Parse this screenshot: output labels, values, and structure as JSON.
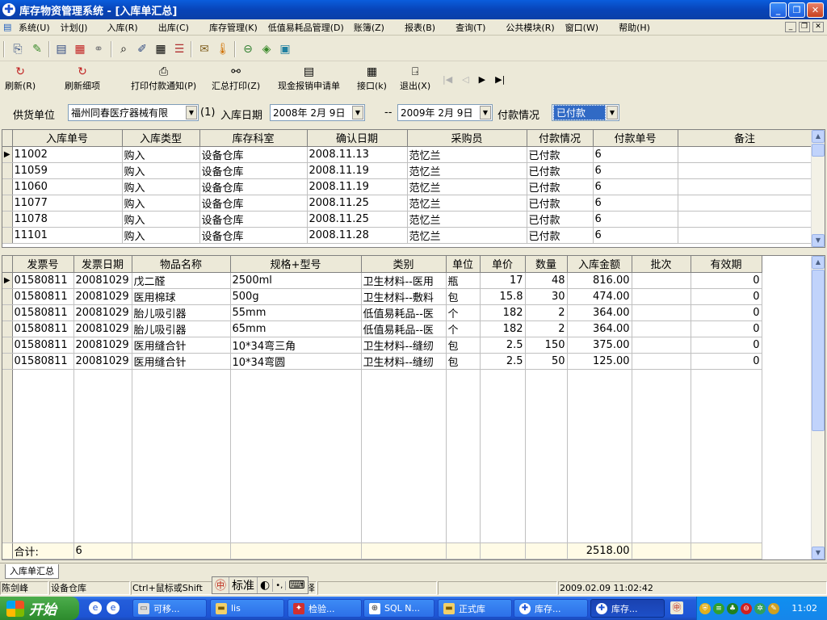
{
  "window": {
    "title": "库存物资管理系统 - [入库单汇总]",
    "app_icon": "cross-icon"
  },
  "menu": [
    "系统(U)",
    "计划(J)",
    "入库(R)",
    "出库(C)",
    "库存管理(K)",
    "低值易耗品管理(D)",
    "账簿(Z)",
    "报表(B)",
    "查询(T)",
    "公共模块(R)",
    "窗口(W)",
    "帮助(H)"
  ],
  "toolbar2": {
    "refresh": "刷新(R)",
    "refresh_detail": "刷新细项",
    "print_notice": "打印付款通知(P)",
    "print_summary": "汇总打印(Z)",
    "cash_request": "现金报销申请单",
    "interface": "接口(k)",
    "exit": "退出(X)"
  },
  "filter": {
    "supplier_label": "供货单位",
    "supplier_value": "福州同春医疗器械有限",
    "marker": "(1)",
    "date_label": "入库日期",
    "date_from": "2008年 2月 9日",
    "dash": "--",
    "date_to": "2009年 2月 9日",
    "payment_label": "付款情况",
    "payment_value": "已付款"
  },
  "top_grid": {
    "headers": [
      "入库单号",
      "入库类型",
      "库存科室",
      "确认日期",
      "采购员",
      "付款情况",
      "付款单号",
      "备注"
    ],
    "rows": [
      [
        "11002",
        "购入",
        "设备仓库",
        "2008.11.13",
        "范忆兰",
        "已付款",
        "6",
        ""
      ],
      [
        "11059",
        "购入",
        "设备仓库",
        "2008.11.19",
        "范忆兰",
        "已付款",
        "6",
        ""
      ],
      [
        "11060",
        "购入",
        "设备仓库",
        "2008.11.19",
        "范忆兰",
        "已付款",
        "6",
        ""
      ],
      [
        "11077",
        "购入",
        "设备仓库",
        "2008.11.25",
        "范忆兰",
        "已付款",
        "6",
        ""
      ],
      [
        "11078",
        "购入",
        "设备仓库",
        "2008.11.25",
        "范忆兰",
        "已付款",
        "6",
        ""
      ],
      [
        "11101",
        "购入",
        "设备仓库",
        "2008.11.28",
        "范忆兰",
        "已付款",
        "6",
        ""
      ]
    ]
  },
  "bottom_grid": {
    "headers": [
      "发票号",
      "发票日期",
      "物品名称",
      "规格+型号",
      "类别",
      "单位",
      "单价",
      "数量",
      "入库金额",
      "批次",
      "有效期"
    ],
    "rows": [
      [
        "01580811",
        "20081029",
        "戊二醛",
        "2500ml",
        "卫生材料--医用",
        "瓶",
        "17",
        "48",
        "816.00",
        "",
        "0"
      ],
      [
        "01580811",
        "20081029",
        "医用棉球",
        "500g",
        "卫生材料--敷料",
        "包",
        "15.8",
        "30",
        "474.00",
        "",
        "0"
      ],
      [
        "01580811",
        "20081029",
        "胎儿吸引器",
        "55mm",
        "低值易耗品--医",
        "个",
        "182",
        "2",
        "364.00",
        "",
        "0"
      ],
      [
        "01580811",
        "20081029",
        "胎儿吸引器",
        "65mm",
        "低值易耗品--医",
        "个",
        "182",
        "2",
        "364.00",
        "",
        "0"
      ],
      [
        "01580811",
        "20081029",
        "医用缝合针",
        "10*34弯三角",
        "卫生材料--缝纫",
        "包",
        "2.5",
        "150",
        "375.00",
        "",
        "0"
      ],
      [
        "01580811",
        "20081029",
        "医用缝合针",
        "10*34弯圆",
        "卫生材料--缝纫",
        "包",
        "2.5",
        "50",
        "125.00",
        "",
        "0"
      ]
    ],
    "summary": {
      "label": "合计:",
      "count": "6",
      "total": "2518.00"
    }
  },
  "tab": "入库单汇总",
  "status": {
    "user": "陈剑峰",
    "dept": "设备仓库",
    "hint": "Ctrl+鼠标或Shift",
    "hint_tail": "择",
    "datetime": "2009.02.09 11:02:42"
  },
  "ime": {
    "mode": "标准"
  },
  "taskbar": {
    "start": "开始",
    "tasks": [
      "可移...",
      "lis",
      "检验...",
      "SQL N...",
      "正式库",
      "库存...",
      "库存..."
    ],
    "clock": "11:02"
  }
}
